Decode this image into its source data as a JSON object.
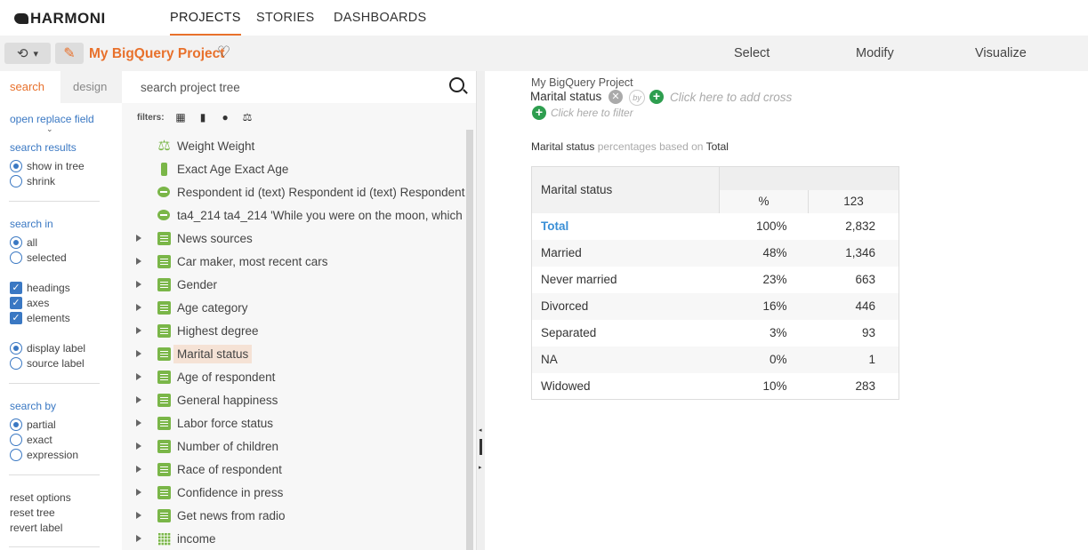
{
  "app": {
    "logo": "HARMONI"
  },
  "nav": {
    "tabs": [
      "PROJECTS",
      "STORIES",
      "DASHBOARDS"
    ]
  },
  "toolbar": {
    "history_caret": "▾",
    "project_title": "My BigQuery Project",
    "actions": [
      "Select",
      "Modify",
      "Visualize"
    ]
  },
  "sidebar": {
    "tabs": [
      "search",
      "design"
    ],
    "open_replace": "open replace field",
    "search_results": {
      "heading": "search results",
      "options": [
        "show in tree",
        "shrink"
      ],
      "selected": "show in tree"
    },
    "search_in": {
      "heading": "search in",
      "options": [
        "all",
        "selected"
      ],
      "selected": "all"
    },
    "include": [
      "headings",
      "axes",
      "elements"
    ],
    "label_mode": {
      "options": [
        "display label",
        "source label"
      ],
      "selected": "display label"
    },
    "search_by": {
      "heading": "search by",
      "options": [
        "partial",
        "exact",
        "expression"
      ],
      "selected": "partial"
    },
    "resets": [
      "reset options",
      "reset tree",
      "revert label"
    ]
  },
  "tree": {
    "search_placeholder": "search project tree",
    "filters_label": "filters:",
    "items": [
      {
        "label": "Weight Weight",
        "icon": "scale-icon",
        "expandable": false
      },
      {
        "label": "Exact Age Exact Age",
        "icon": "ruler-icon",
        "expandable": false
      },
      {
        "label": "Respondent id (text) Respondent id (text) Respondent id (te",
        "icon": "text-bubble-icon",
        "expandable": false
      },
      {
        "label": "ta4_214 ta4_214 'While you were on the moon, which",
        "icon": "text-bubble-icon",
        "expandable": false
      },
      {
        "label": "News sources",
        "icon": "list-icon",
        "expandable": true
      },
      {
        "label": "Car maker, most recent cars",
        "icon": "list-icon",
        "expandable": true
      },
      {
        "label": "Gender",
        "icon": "list-icon",
        "expandable": true
      },
      {
        "label": "Age category",
        "icon": "list-icon",
        "expandable": true
      },
      {
        "label": "Highest degree",
        "icon": "list-icon",
        "expandable": true
      },
      {
        "label": "Marital status",
        "icon": "list-icon",
        "expandable": true,
        "selected": true
      },
      {
        "label": "Age of respondent",
        "icon": "list-icon",
        "expandable": true
      },
      {
        "label": "General happiness",
        "icon": "list-icon",
        "expandable": true
      },
      {
        "label": "Labor force status",
        "icon": "list-icon",
        "expandable": true
      },
      {
        "label": "Number of children",
        "icon": "list-icon",
        "expandable": true
      },
      {
        "label": "Race of respondent",
        "icon": "list-icon",
        "expandable": true
      },
      {
        "label": "Confidence in press",
        "icon": "list-icon",
        "expandable": true
      },
      {
        "label": "Get news from radio",
        "icon": "list-icon",
        "expandable": true
      },
      {
        "label": "income",
        "icon": "grid-icon",
        "expandable": true
      }
    ]
  },
  "main": {
    "breadcrumb": "My BigQuery Project",
    "variable": "Marital status",
    "by_label": "by",
    "add_cross_hint": "Click here to add cross",
    "add_filter_hint": "Click here to filter",
    "caption": {
      "var": "Marital status",
      "middle": "percentages based on",
      "base": "Total"
    },
    "table": {
      "row_header": "Marital status",
      "col_headers": [
        "%",
        "123"
      ],
      "rows": [
        {
          "label": "Total",
          "pct": "100%",
          "count": "2,832"
        },
        {
          "label": "Married",
          "pct": "48%",
          "count": "1,346"
        },
        {
          "label": "Never married",
          "pct": "23%",
          "count": "663"
        },
        {
          "label": "Divorced",
          "pct": "16%",
          "count": "446"
        },
        {
          "label": "Separated",
          "pct": "3%",
          "count": "93"
        },
        {
          "label": "NA",
          "pct": "0%",
          "count": "1"
        },
        {
          "label": "Widowed",
          "pct": "10%",
          "count": "283"
        }
      ]
    }
  },
  "colors": {
    "accent": "#e8712c",
    "link": "#3a78c3",
    "icon_green": "#7ab648",
    "add_green": "#2e9e4f",
    "total_blue": "#3a8fd6"
  }
}
